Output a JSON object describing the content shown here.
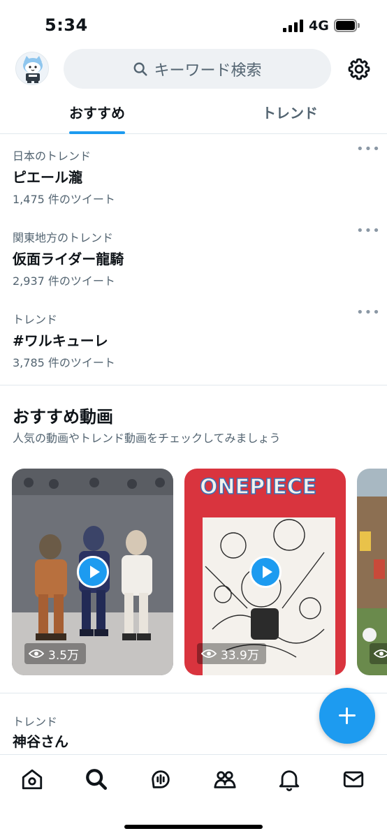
{
  "status_bar": {
    "time": "5:34",
    "network": "4G",
    "icons": [
      "signal-icon",
      "battery-icon"
    ]
  },
  "header": {
    "search": {
      "placeholder": "キーワード検索",
      "icon": "search-icon"
    },
    "settings_icon": "gear-icon",
    "avatar": "profile-avatar"
  },
  "tabs": [
    {
      "label": "おすすめ",
      "active": true
    },
    {
      "label": "トレンド",
      "active": false
    }
  ],
  "trends": [
    {
      "context": "日本のトレンド",
      "name": "ピエール瀧",
      "count": "1,475 件のツイート",
      "more": "•••"
    },
    {
      "context": "関東地方のトレンド",
      "name": "仮面ライダー龍騎",
      "count": "2,937 件のツイート",
      "more": "•••"
    },
    {
      "context": "トレンド",
      "name": "#ワルキューレ",
      "count": "3,785 件のツイート",
      "more": "•••"
    }
  ],
  "recommended_videos": {
    "title": "おすすめ動画",
    "subtitle": "人気の動画やトレンド動画をチェックしてみましょう",
    "videos": [
      {
        "views": "3.5万",
        "play_icon": "play-icon"
      },
      {
        "views": "33.9万",
        "play_icon": "play-icon",
        "title_art": "ONEPIECE"
      },
      {
        "views": "",
        "play_icon": "play-icon"
      }
    ]
  },
  "trend_partial": {
    "context": "トレンド",
    "name": "神谷さん"
  },
  "fab": {
    "icon": "plus-icon"
  },
  "tabbar": [
    "home-icon",
    "search-icon",
    "spaces-icon",
    "communities-icon",
    "bell-icon",
    "mail-icon"
  ],
  "colors": {
    "accent": "#1d9bf0",
    "text": "#0f1419",
    "secondary": "#536471",
    "divider": "#e1e8ed"
  }
}
